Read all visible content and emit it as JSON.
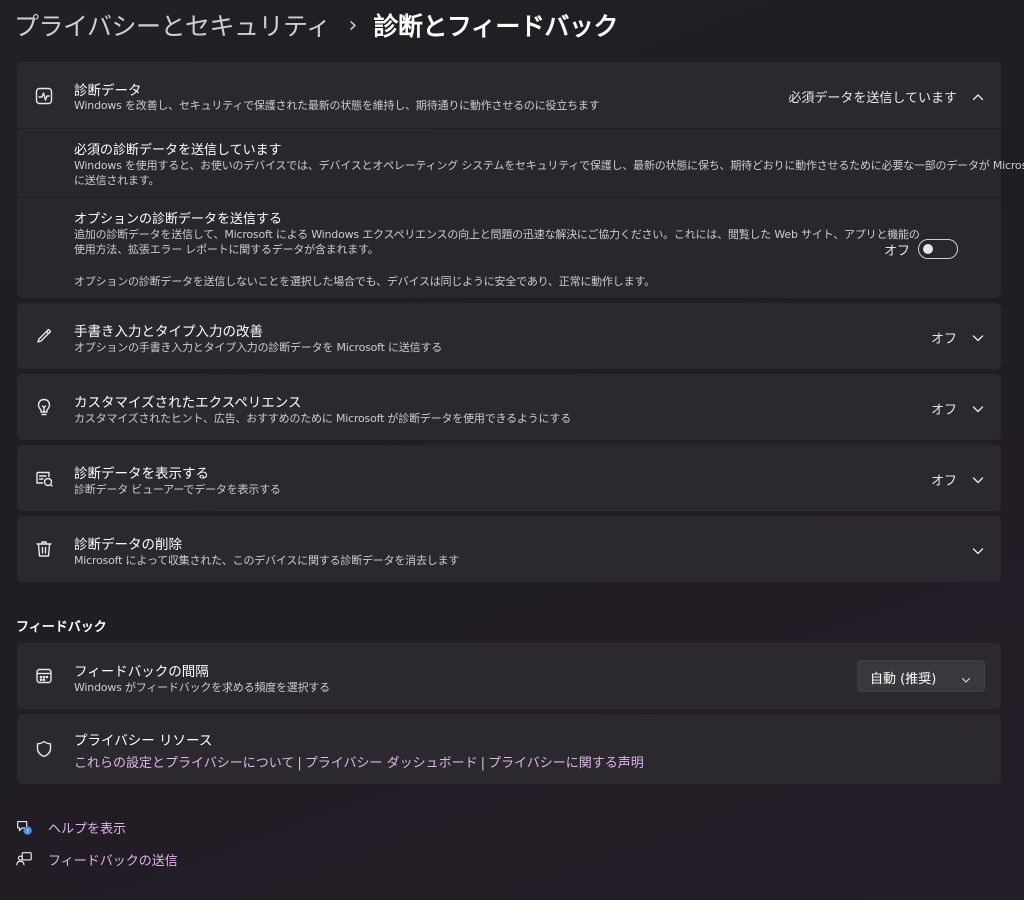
{
  "breadcrumb": {
    "parent": "プライバシーとセキュリティ",
    "separator": "›",
    "current": "診断とフィードバック"
  },
  "diagnostic_data": {
    "title": "診断データ",
    "description": "Windows を改善し、セキュリティで保護された最新の状態を維持し、期待通りに動作させるのに役立ちます",
    "status": "必須データを送信しています",
    "expanded": true,
    "icon": "pulse-icon",
    "required": {
      "title": "必須の診断データを送信しています",
      "line1": "Windows を使用すると、お使いのデバイスでは、デバイスとオペレーティング システムをセキュリティで保護し、最新の状態に保ち、期待どおりに動作させるために必要な一部のデータが Microsoft",
      "line2": "に送信されます。"
    },
    "optional": {
      "title": "オプションの診断データを送信する",
      "line1": "追加の診断データを送信して、Microsoft による Windows エクスペリエンスの向上と問題の迅速な解決にご協力ください。これには、閲覧した Web サイト、アプリと機能の",
      "line2": "使用方法、拡張エラー レポートに関するデータが含まれます。",
      "line3": "オプションの診断データを送信しないことを選択した場合でも、デバイスは同じように安全であり、正常に動作します。",
      "toggle_label": "オフ",
      "toggle_on": false
    }
  },
  "settings": [
    {
      "title": "手書き入力とタイプ入力の改善",
      "description": "オプションの手書き入力とタイプ入力の診断データを Microsoft に送信する",
      "value": "オフ",
      "icon": "pen-icon"
    },
    {
      "title": "カスタマイズされたエクスペリエンス",
      "description": "カスタマイズされたヒント、広告、おすすめのために Microsoft が診断データを使用できるようにする",
      "value": "オフ",
      "icon": "lightbulb-icon"
    },
    {
      "title": "診断データを表示する",
      "description": "診断データ ビューアーでデータを表示する",
      "value": "オフ",
      "icon": "data-viewer-icon"
    },
    {
      "title": "診断データの削除",
      "description": "Microsoft によって収集された、このデバイスに関する診断データを消去します",
      "value": "",
      "icon": "trash-icon"
    }
  ],
  "feedback_section": {
    "header": "フィードバック",
    "frequency": {
      "title": "フィードバックの間隔",
      "description": "Windows がフィードバックを求める頻度を選択する",
      "selected": "自動 (推奨)",
      "icon": "calendar-icon"
    },
    "privacy": {
      "title": "プライバシー リソース",
      "icon": "shield-icon",
      "links": [
        "これらの設定とプライバシーについて",
        "プライバシー ダッシュボード",
        "プライバシーに関する声明"
      ],
      "separator": "|"
    }
  },
  "footer": {
    "help": "ヘルプを表示",
    "feedback": "フィードバックの送信"
  },
  "colors": {
    "background": "#211e24",
    "card": "#2b282e",
    "link": "#e0b3ec",
    "text": "#ffffff",
    "subtext": "#cdcdcd"
  }
}
